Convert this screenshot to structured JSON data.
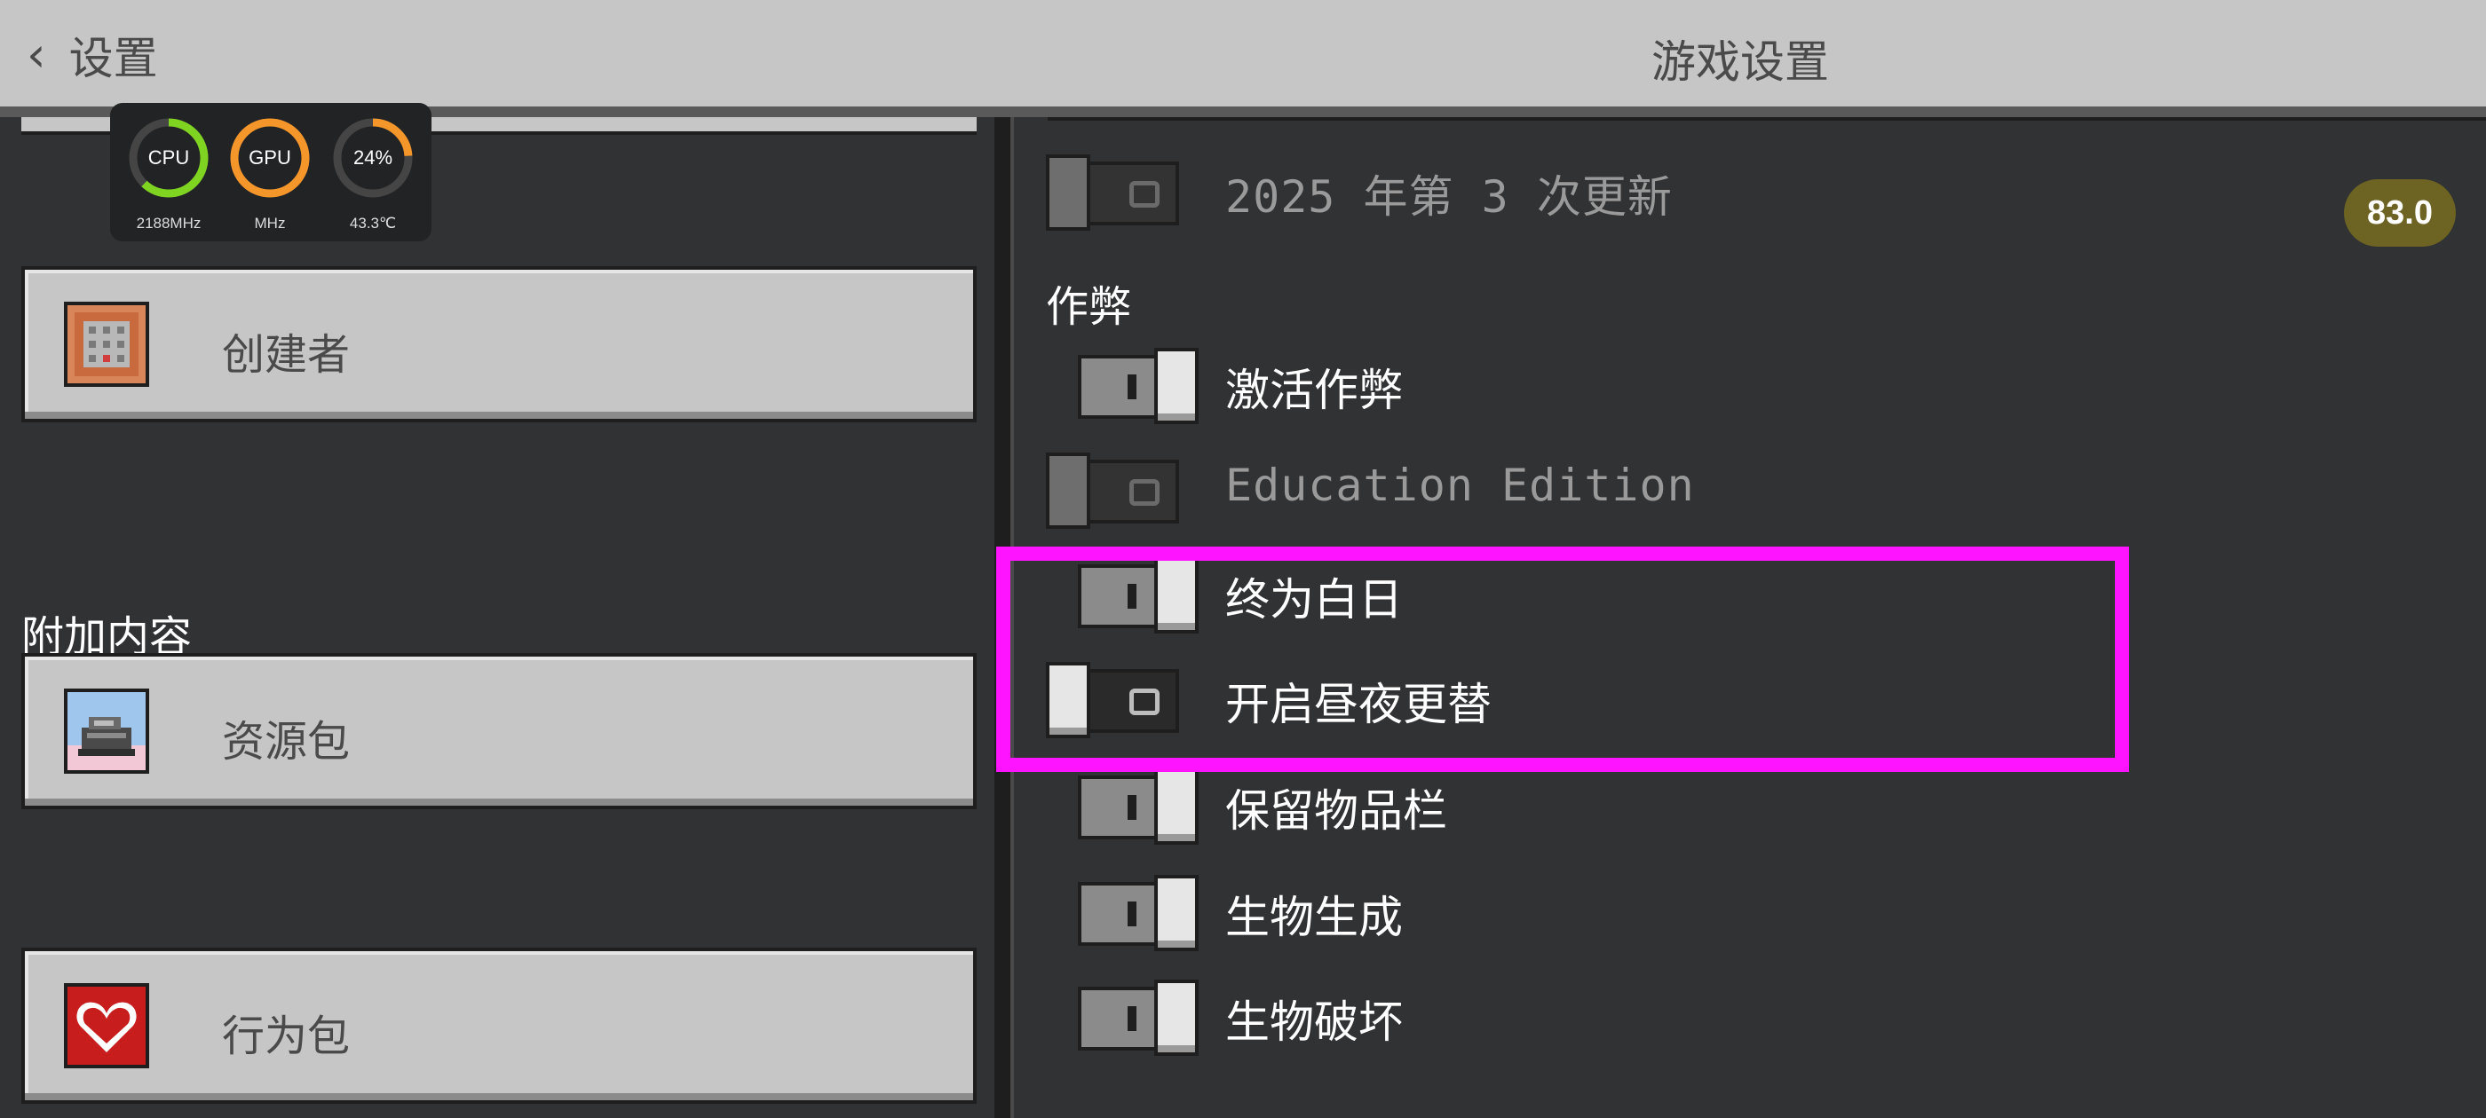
{
  "header": {
    "back_label": "设置",
    "back_icon": "chevron-left-icon",
    "title": "游戏设置"
  },
  "performance_overlay": {
    "cpu": {
      "label": "CPU",
      "sub": "2188MHz",
      "fill": 0.62,
      "color": "#7fd321"
    },
    "gpu": {
      "label": "GPU",
      "sub": "MHz",
      "fill": 1.0,
      "color": "#f5962a"
    },
    "temp": {
      "label": "24%",
      "sub": "43.3℃",
      "fill": 0.24,
      "color": "#f5962a"
    }
  },
  "fps_badge": "83.0",
  "sidebar": {
    "creator_label": "创建者",
    "addons_section": "附加内容",
    "resource_pack_label": "资源包",
    "behavior_pack_label": "行为包"
  },
  "settings": {
    "update_row": {
      "label": "2025 年第 3 次更新",
      "state": "off",
      "enabled": false
    },
    "cheats_section": "作弊",
    "rows": [
      {
        "key": "activate_cheats",
        "label": "激活作弊",
        "state": "on",
        "enabled": true
      },
      {
        "key": "education_edition",
        "label": "Education Edition",
        "state": "off",
        "enabled": false
      },
      {
        "key": "always_day",
        "label": "终为白日",
        "state": "on",
        "enabled": true
      },
      {
        "key": "daylight_cycle",
        "label": "开启昼夜更替",
        "state": "off",
        "enabled": true
      },
      {
        "key": "keep_inventory",
        "label": "保留物品栏",
        "state": "on",
        "enabled": true
      },
      {
        "key": "mob_spawning",
        "label": "生物生成",
        "state": "on",
        "enabled": true
      },
      {
        "key": "mob_griefing",
        "label": "生物破坏",
        "state": "on",
        "enabled": true
      }
    ]
  },
  "colors": {
    "highlight": "#ff14ff",
    "panel_bg": "#313233",
    "header_bg": "#c6c6c6"
  }
}
